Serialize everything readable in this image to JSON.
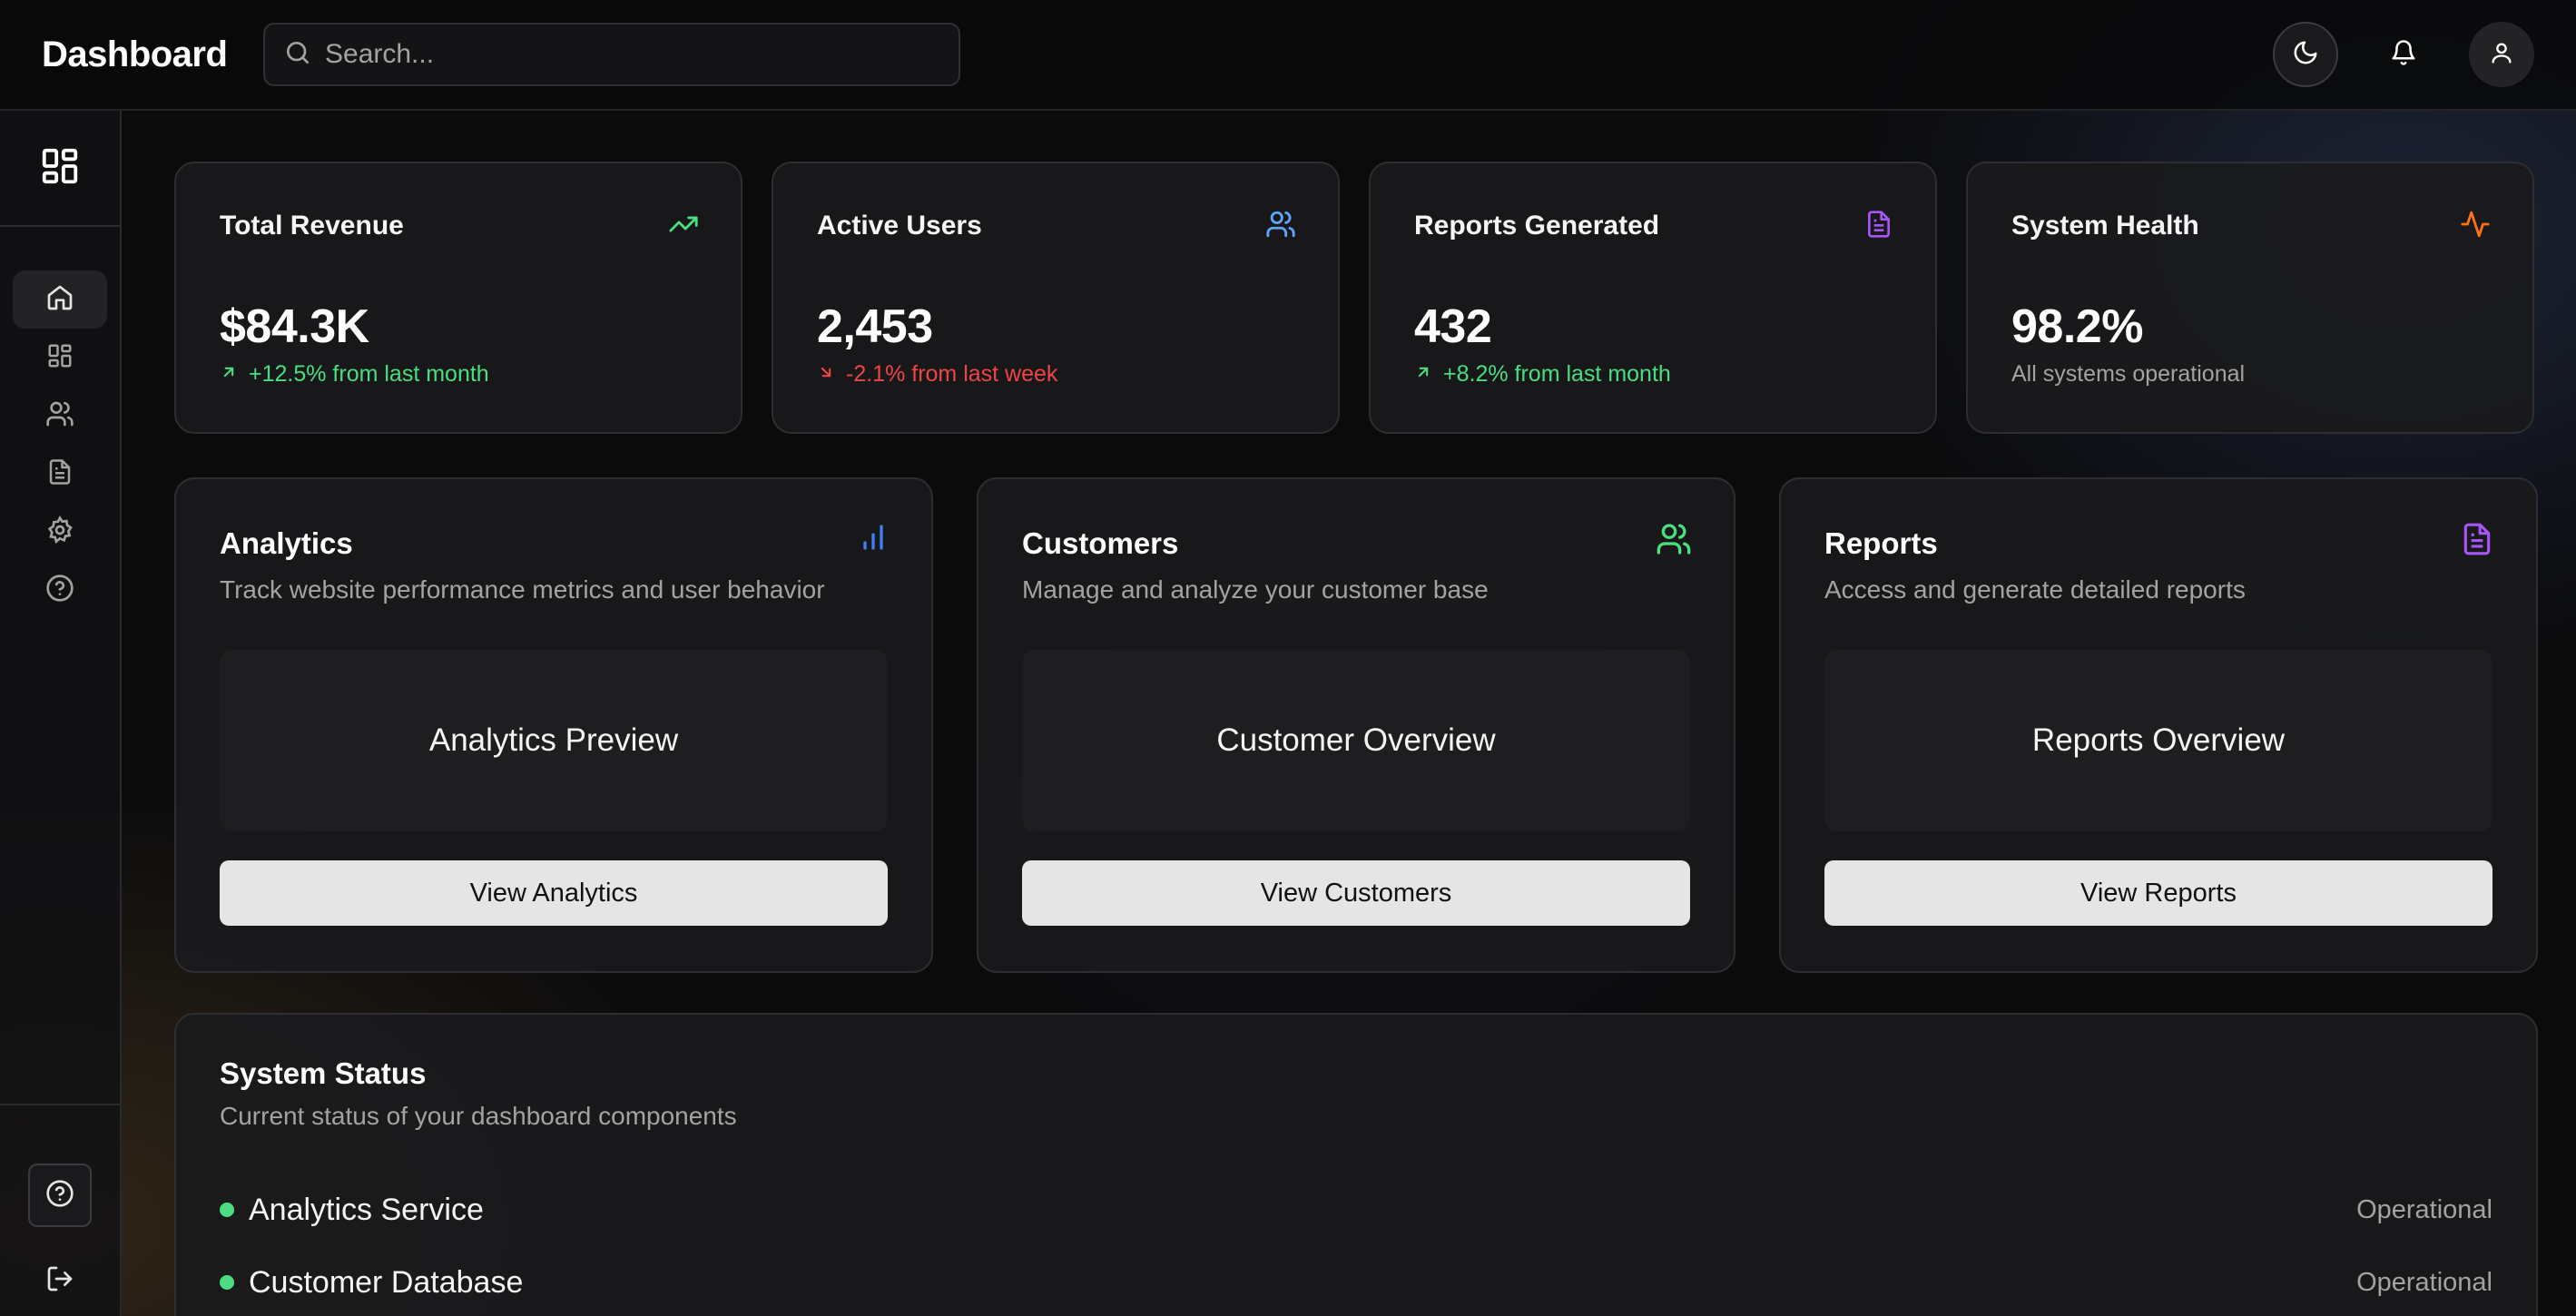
{
  "header": {
    "brand": "Dashboard",
    "search_placeholder": "Search..."
  },
  "sidebar": {
    "items": [
      {
        "icon": "home-icon",
        "active": true
      },
      {
        "icon": "grid-icon"
      },
      {
        "icon": "users-icon"
      },
      {
        "icon": "file-text-icon"
      },
      {
        "icon": "settings-icon"
      },
      {
        "icon": "help-circle-icon"
      }
    ],
    "bottom": [
      {
        "icon": "help-circle-icon"
      },
      {
        "icon": "logout-icon"
      }
    ]
  },
  "stats": [
    {
      "title": "Total Revenue",
      "value": "$84.3K",
      "change": "+12.5% from last month",
      "trend": "up",
      "icon": "trending-up-icon",
      "color": "#4ade80"
    },
    {
      "title": "Active Users",
      "value": "2,453",
      "change": "-2.1% from last week",
      "trend": "down",
      "icon": "users-icon",
      "color": "#60a5fa"
    },
    {
      "title": "Reports Generated",
      "value": "432",
      "change": "+8.2% from last month",
      "trend": "up",
      "icon": "file-text-icon",
      "color": "#a855f7"
    },
    {
      "title": "System Health",
      "value": "98.2%",
      "change": "All systems operational",
      "trend": "none",
      "icon": "activity-icon",
      "color": "#f97316"
    }
  ],
  "features": [
    {
      "title": "Analytics",
      "description": "Track website performance metrics and user behavior",
      "preview": "Analytics Preview",
      "button": "View Analytics",
      "icon": "bar-chart-icon",
      "color": "#3b82f6"
    },
    {
      "title": "Customers",
      "description": "Manage and analyze your customer base",
      "preview": "Customer Overview",
      "button": "View Customers",
      "icon": "users-icon",
      "color": "#4ade80"
    },
    {
      "title": "Reports",
      "description": "Access and generate detailed reports",
      "preview": "Reports Overview",
      "button": "View Reports",
      "icon": "file-text-icon",
      "color": "#a855f7"
    }
  ],
  "system_status": {
    "title": "System Status",
    "description": "Current status of your dashboard components",
    "items": [
      {
        "name": "Analytics Service",
        "state": "Operational"
      },
      {
        "name": "Customer Database",
        "state": "Operational"
      }
    ]
  }
}
